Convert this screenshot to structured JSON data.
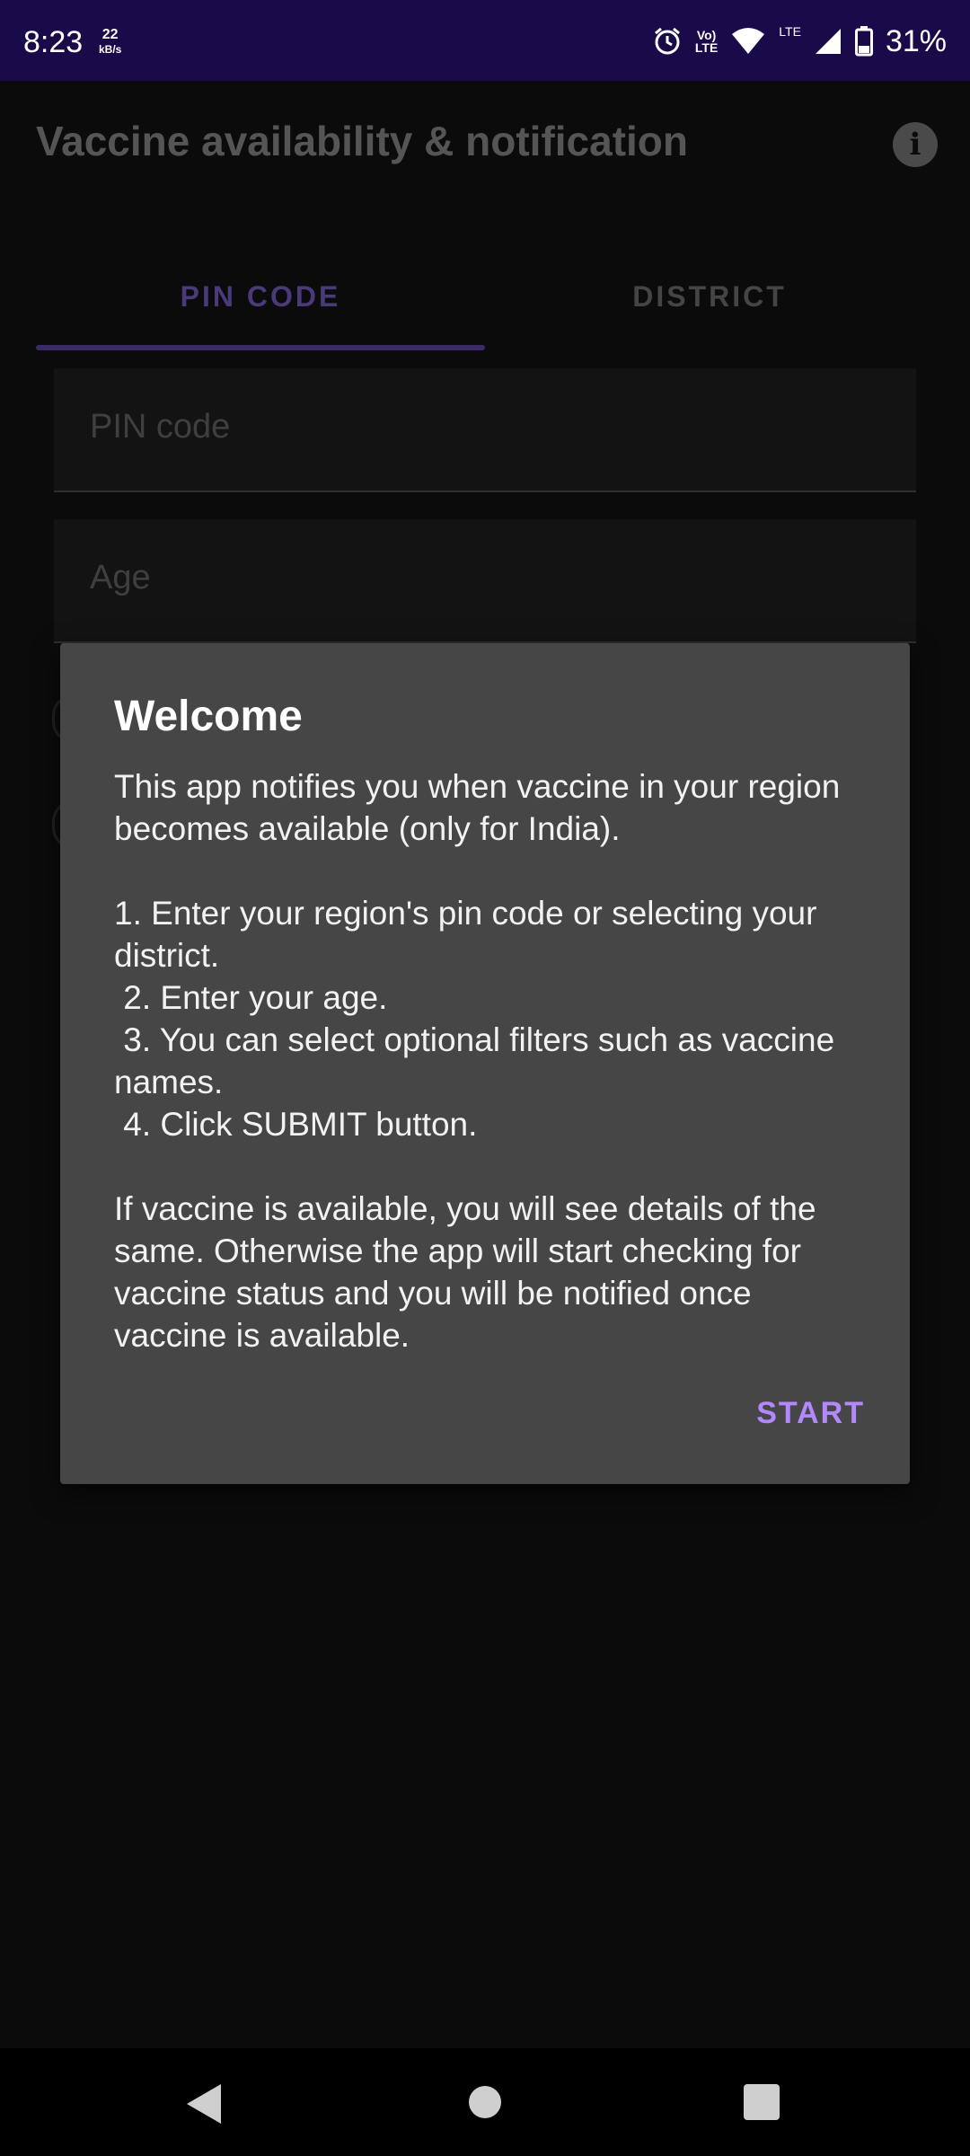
{
  "status_bar": {
    "time": "8:23",
    "speed_value": "22",
    "speed_unit": "kB/s",
    "volte_top": "Vo)",
    "volte_bottom": "LTE",
    "lte_label": "LTE",
    "battery": "31%",
    "icons": [
      "alarm-icon",
      "volte-icon",
      "wifi-icon",
      "signal-icon",
      "battery-icon"
    ]
  },
  "app_bar": {
    "title": "Vaccine availability & notification",
    "info_glyph": "i"
  },
  "tabs": [
    {
      "label": "PIN CODE",
      "selected": true
    },
    {
      "label": "DISTRICT",
      "selected": false
    }
  ],
  "form": {
    "pin_placeholder": "PIN code",
    "age_placeholder": "Age"
  },
  "dialog": {
    "title": "Welcome",
    "body": "This app notifies you when vaccine in your region becomes available (only for India).\n\n1. Enter your region's pin code or selecting your district.\n 2. Enter your age.\n 3. You can select optional filters such as vaccine names.\n 4. Click SUBMIT button.\n\nIf vaccine is available, you will see details of the same. Otherwise the app will start checking for vaccine status and you will be notified once vaccine is available.",
    "button_label": "START"
  },
  "colors": {
    "status_bar": "#1a0a4a",
    "accent": "#b388ff",
    "dialog_bg": "#464646"
  }
}
